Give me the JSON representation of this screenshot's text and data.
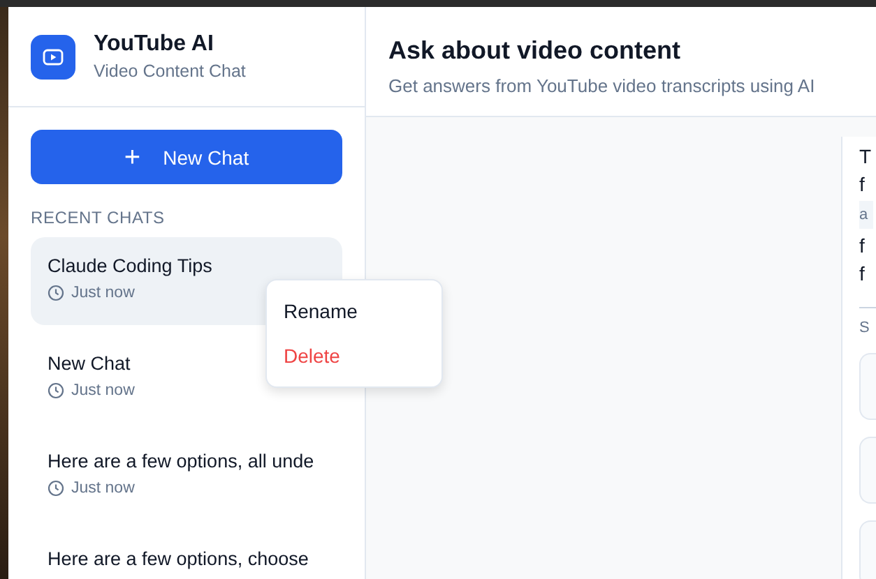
{
  "app": {
    "name": "YouTube AI",
    "subtitle": "Video Content Chat"
  },
  "new_chat_button": {
    "label": "New Chat",
    "icon": "+"
  },
  "recent_chats": {
    "heading": "RECENT CHATS",
    "items": [
      {
        "title": "Claude Coding Tips",
        "time": "Just now",
        "selected": true
      },
      {
        "title": "New Chat",
        "time": "Just now",
        "selected": false
      },
      {
        "title": "Here are a few options, all unde",
        "time": "Just now",
        "selected": false
      },
      {
        "title": "Here are a few options, choose",
        "selected": false
      }
    ]
  },
  "context_menu": {
    "items": [
      {
        "label": "Rename",
        "kind": "normal"
      },
      {
        "label": "Delete",
        "kind": "danger"
      }
    ]
  },
  "main": {
    "title": "Ask about video content",
    "subtitle": "Get answers from YouTube video transcripts using AI"
  },
  "message_card": {
    "lines": [
      {
        "text": "T",
        "kind": "text"
      },
      {
        "text": "f",
        "kind": "text"
      },
      {
        "text": "a",
        "kind": "code"
      },
      {
        "text": "f",
        "kind": "text"
      },
      {
        "text": "f",
        "kind": "text"
      }
    ],
    "section_label": "S"
  }
}
